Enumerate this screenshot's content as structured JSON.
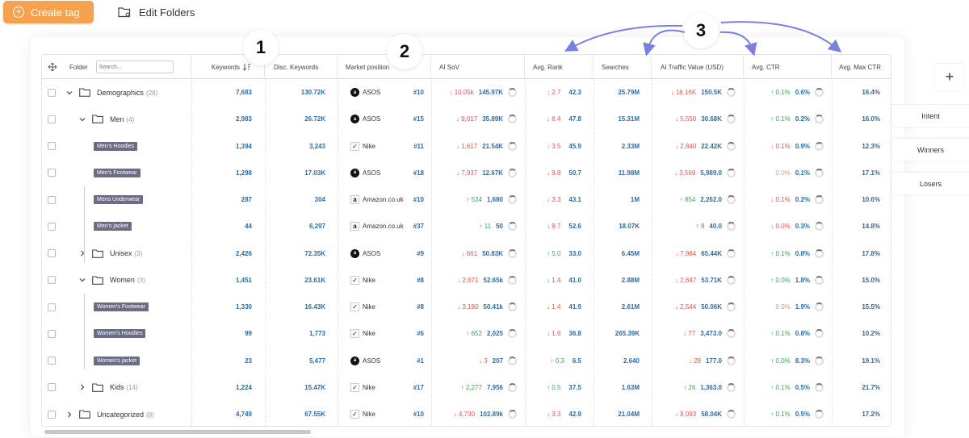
{
  "toolbar": {
    "create_label": "Create tag",
    "edit_label": "Edit Folders"
  },
  "search": {
    "placeholder": "Search..."
  },
  "headers": {
    "folder": "Folder",
    "keywords": "Keywords",
    "disc_keywords": "Disc. Keywords",
    "market_position": "Market position",
    "ai_sov": "AI SoV",
    "avg_rank": "Avg. Rank",
    "searches": "Searches",
    "ai_traffic": "AI Traffic Value (USD)",
    "avg_ctr": "Avg. CTR",
    "avg_max_ctr": "Avg. Max CTR"
  },
  "callouts": [
    "1",
    "2",
    "3"
  ],
  "side_panel": {
    "add": "+",
    "items": [
      "Intent",
      "Winners",
      "Losers"
    ]
  },
  "colors": {
    "accent": "#f5a14e",
    "up": "#3aa55a",
    "down": "#e05353",
    "link": "#2d6ca0",
    "tag": "#6b6d86",
    "arrow": "#7b7fe0"
  },
  "rows": [
    {
      "type": "folder",
      "level": 0,
      "expand": "down",
      "name": "Demographics",
      "count": "(28)",
      "kw": "7,683",
      "disc": "130.72K",
      "brand": "ASOS",
      "logo": "asos",
      "pos": "#10",
      "sov_dir": "down",
      "sov_d": "10.05k",
      "sov": "145.97K",
      "rank_dir": "down",
      "rank_d": "2.7",
      "rank": "42.3",
      "searches": "25.79M",
      "tr_dir": "down",
      "tr_d": "16.16K",
      "tr": "150.5K",
      "ctr_dir": "up",
      "ctr_d": "0.1%",
      "ctr": "0.6%",
      "max": "16.4%"
    },
    {
      "type": "folder",
      "level": 1,
      "expand": "down",
      "name": "Men",
      "count": "(4)",
      "kw": "2,983",
      "disc": "26.72K",
      "brand": "ASOS",
      "logo": "asos",
      "pos": "#15",
      "sov_dir": "down",
      "sov_d": "9,017",
      "sov": "35.89K",
      "rank_dir": "down",
      "rank_d": "6.4",
      "rank": "47.8",
      "searches": "15.31M",
      "tr_dir": "down",
      "tr_d": "5,550",
      "tr": "30.68K",
      "ctr_dir": "up",
      "ctr_d": "0.1%",
      "ctr": "0.2%",
      "max": "16.0%"
    },
    {
      "type": "tag",
      "level": 2,
      "name": "Men's Hoodies",
      "kw": "1,394",
      "disc": "3,243",
      "brand": "Nike",
      "logo": "nike",
      "pos": "#11",
      "sov_dir": "down",
      "sov_d": "1,617",
      "sov": "21.54K",
      "rank_dir": "down",
      "rank_d": "3.5",
      "rank": "45.9",
      "searches": "2.33M",
      "tr_dir": "down",
      "tr_d": "2,840",
      "tr": "22.42K",
      "ctr_dir": "down",
      "ctr_d": "0.1%",
      "ctr": "0.9%",
      "max": "12.3%"
    },
    {
      "type": "tag",
      "level": 2,
      "name": "Men's Footwear",
      "kw": "1,298",
      "disc": "17.03K",
      "brand": "ASOS",
      "logo": "asos",
      "pos": "#18",
      "sov_dir": "down",
      "sov_d": "7,937",
      "sov": "12.67K",
      "rank_dir": "down",
      "rank_d": "9.8",
      "rank": "50.7",
      "searches": "11.98M",
      "tr_dir": "down",
      "tr_d": "3,569",
      "tr": "5,989.0",
      "ctr_dir": "none",
      "ctr_d": "0.0%",
      "ctr": "0.1%",
      "max": "17.1%"
    },
    {
      "type": "tag",
      "level": 2,
      "name": "Mens Underwear",
      "kw": "287",
      "disc": "304",
      "brand": "Amazon.co.uk",
      "logo": "amazon",
      "pos": "#10",
      "sov_dir": "up",
      "sov_d": "534",
      "sov": "1,680",
      "rank_dir": "down",
      "rank_d": "3.3",
      "rank": "43.1",
      "searches": "1M",
      "tr_dir": "up",
      "tr_d": "854",
      "tr": "2,262.0",
      "ctr_dir": "down",
      "ctr_d": "0.1%",
      "ctr": "0.2%",
      "max": "10.6%"
    },
    {
      "type": "tag",
      "level": 2,
      "name": "Men's jacket",
      "kw": "44",
      "disc": "6,297",
      "brand": "Amazon.co.uk",
      "logo": "amazon",
      "pos": "#37",
      "sov_dir": "up",
      "sov_d": "11",
      "sov": "50",
      "rank_dir": "down",
      "rank_d": "8.7",
      "rank": "52.6",
      "searches": "18.07K",
      "tr_dir": "up",
      "tr_d": "8",
      "tr": "40.0",
      "ctr_dir": "down",
      "ctr_d": "0.0%",
      "ctr": "0.3%",
      "max": "14.8%"
    },
    {
      "type": "folder",
      "level": 1,
      "expand": "right",
      "name": "Unisex",
      "count": "(3)",
      "kw": "2,426",
      "disc": "72.35K",
      "brand": "ASOS",
      "logo": "asos",
      "pos": "#9",
      "sov_dir": "down",
      "sov_d": "661",
      "sov": "50.83K",
      "rank_dir": "up",
      "rank_d": "5.0",
      "rank": "33.0",
      "searches": "6.45M",
      "tr_dir": "down",
      "tr_d": "7,984",
      "tr": "65.44K",
      "ctr_dir": "up",
      "ctr_d": "0.1%",
      "ctr": "0.8%",
      "max": "17.8%"
    },
    {
      "type": "folder",
      "level": 1,
      "expand": "down",
      "name": "Women",
      "count": "(3)",
      "kw": "1,451",
      "disc": "23.61K",
      "brand": "Nike",
      "logo": "nike",
      "pos": "#8",
      "sov_dir": "down",
      "sov_d": "2,671",
      "sov": "52.65k",
      "rank_dir": "down",
      "rank_d": "1.4",
      "rank": "41.0",
      "searches": "2.88M",
      "tr_dir": "down",
      "tr_d": "2,647",
      "tr": "53.71K",
      "ctr_dir": "up",
      "ctr_d": "0.0%",
      "ctr": "1.8%",
      "max": "15.0%"
    },
    {
      "type": "tag",
      "level": 2,
      "name": "Women's Footwear",
      "kw": "1,330",
      "disc": "16.43K",
      "brand": "Nike",
      "logo": "nike",
      "pos": "#8",
      "sov_dir": "down",
      "sov_d": "3,180",
      "sov": "50.41k",
      "rank_dir": "down",
      "rank_d": "1.4",
      "rank": "41.9",
      "searches": "2.61M",
      "tr_dir": "down",
      "tr_d": "2,544",
      "tr": "50.06K",
      "ctr_dir": "none",
      "ctr_d": "0.0%",
      "ctr": "1.9%",
      "max": "15.5%"
    },
    {
      "type": "tag",
      "level": 2,
      "name": "Women's Hoodies",
      "kw": "99",
      "disc": "1,773",
      "brand": "Nike",
      "logo": "nike",
      "pos": "#6",
      "sov_dir": "up",
      "sov_d": "652",
      "sov": "2,025",
      "rank_dir": "down",
      "rank_d": "1.6",
      "rank": "36.8",
      "searches": "265.39K",
      "tr_dir": "down",
      "tr_d": "77",
      "tr": "3,473.0",
      "ctr_dir": "up",
      "ctr_d": "0.1%",
      "ctr": "0.8%",
      "max": "10.2%"
    },
    {
      "type": "tag",
      "level": 2,
      "name": "Women's jacket",
      "kw": "23",
      "disc": "5,477",
      "brand": "ASOS",
      "logo": "asos",
      "pos": "#1",
      "sov_dir": "down",
      "sov_d": "3",
      "sov": "207",
      "rank_dir": "up",
      "rank_d": "0.3",
      "rank": "6.5",
      "searches": "2.640",
      "tr_dir": "down",
      "tr_d": "29",
      "tr": "177.0",
      "ctr_dir": "up",
      "ctr_d": "0.0%",
      "ctr": "8.3%",
      "max": "19.1%"
    },
    {
      "type": "folder",
      "level": 1,
      "expand": "right",
      "name": "Kids",
      "count": "(14)",
      "kw": "1,224",
      "disc": "15.47K",
      "brand": "Nike",
      "logo": "nike",
      "pos": "#17",
      "sov_dir": "up",
      "sov_d": "2,277",
      "sov": "7,956",
      "rank_dir": "up",
      "rank_d": "0.5",
      "rank": "37.5",
      "searches": "1.63M",
      "tr_dir": "up",
      "tr_d": "26",
      "tr": "1,363.0",
      "ctr_dir": "up",
      "ctr_d": "0.1%",
      "ctr": "0.5%",
      "max": "21.7%"
    },
    {
      "type": "folder",
      "level": 0,
      "expand": "right",
      "name": "Uncategorized",
      "count": "(8)",
      "kw": "4,749",
      "disc": "67.55K",
      "brand": "Nike",
      "logo": "nike",
      "pos": "#10",
      "sov_dir": "down",
      "sov_d": "4,730",
      "sov": "102.89k",
      "rank_dir": "down",
      "rank_d": "3.3",
      "rank": "42.9",
      "searches": "21.04M",
      "tr_dir": "down",
      "tr_d": "8,093",
      "tr": "58.04K",
      "ctr_dir": "up",
      "ctr_d": "0.1%",
      "ctr": "0.5%",
      "max": "17.2%"
    }
  ]
}
